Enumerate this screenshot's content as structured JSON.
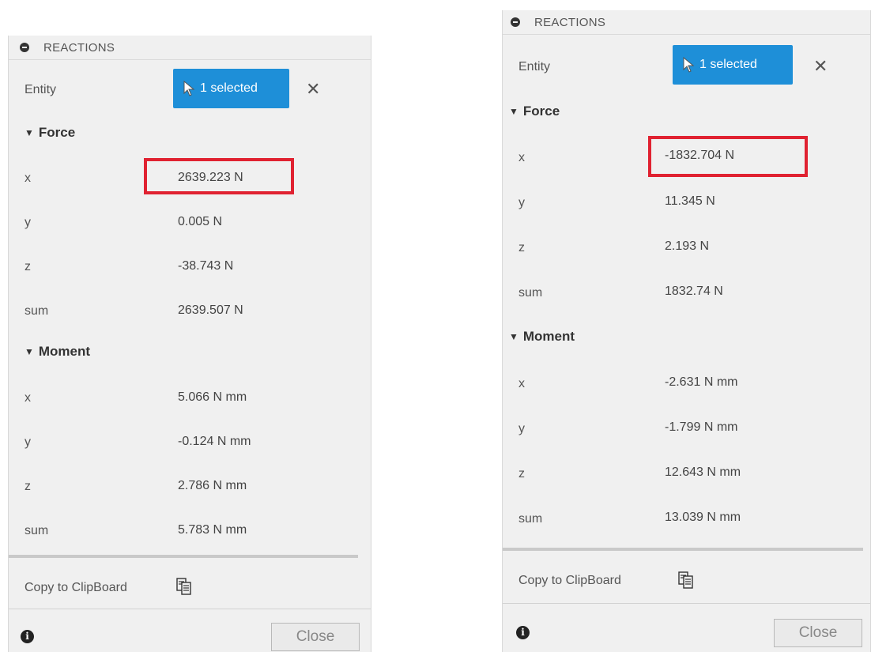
{
  "panels": [
    {
      "header": "REACTIONS",
      "entity_label": "Entity",
      "selection_label": "1 selected",
      "force": {
        "title": "Force",
        "rows": [
          {
            "axis": "x",
            "value": "2639.223 N"
          },
          {
            "axis": "y",
            "value": "0.005 N"
          },
          {
            "axis": "z",
            "value": "-38.743 N"
          },
          {
            "axis": "sum",
            "value": "2639.507 N"
          }
        ]
      },
      "moment": {
        "title": "Moment",
        "rows": [
          {
            "axis": "x",
            "value": "5.066 N mm"
          },
          {
            "axis": "y",
            "value": "-0.124 N mm"
          },
          {
            "axis": "z",
            "value": "2.786 N mm"
          },
          {
            "axis": "sum",
            "value": "5.783 N mm"
          }
        ]
      },
      "copy_label": "Copy to ClipBoard",
      "close_label": "Close"
    },
    {
      "header": "REACTIONS",
      "entity_label": "Entity",
      "selection_label": "1 selected",
      "force": {
        "title": "Force",
        "rows": [
          {
            "axis": "x",
            "value": "-1832.704 N"
          },
          {
            "axis": "y",
            "value": "11.345 N"
          },
          {
            "axis": "z",
            "value": "2.193 N"
          },
          {
            "axis": "sum",
            "value": "1832.74 N"
          }
        ]
      },
      "moment": {
        "title": "Moment",
        "rows": [
          {
            "axis": "x",
            "value": "-2.631 N mm"
          },
          {
            "axis": "y",
            "value": "-1.799 N mm"
          },
          {
            "axis": "z",
            "value": "12.643 N mm"
          },
          {
            "axis": "sum",
            "value": "13.039 N mm"
          }
        ]
      },
      "copy_label": "Copy to ClipBoard",
      "close_label": "Close"
    }
  ],
  "colors": {
    "accent": "#1e8fd8",
    "highlight": "#e02231",
    "panel_bg": "#f0f0f0"
  },
  "icons": {
    "collapse": "collapse-circle-icon",
    "cursor": "cursor-arrow-icon",
    "clear": "close-icon",
    "clipboard": "clipboard-copy-icon",
    "info": "info-icon"
  }
}
